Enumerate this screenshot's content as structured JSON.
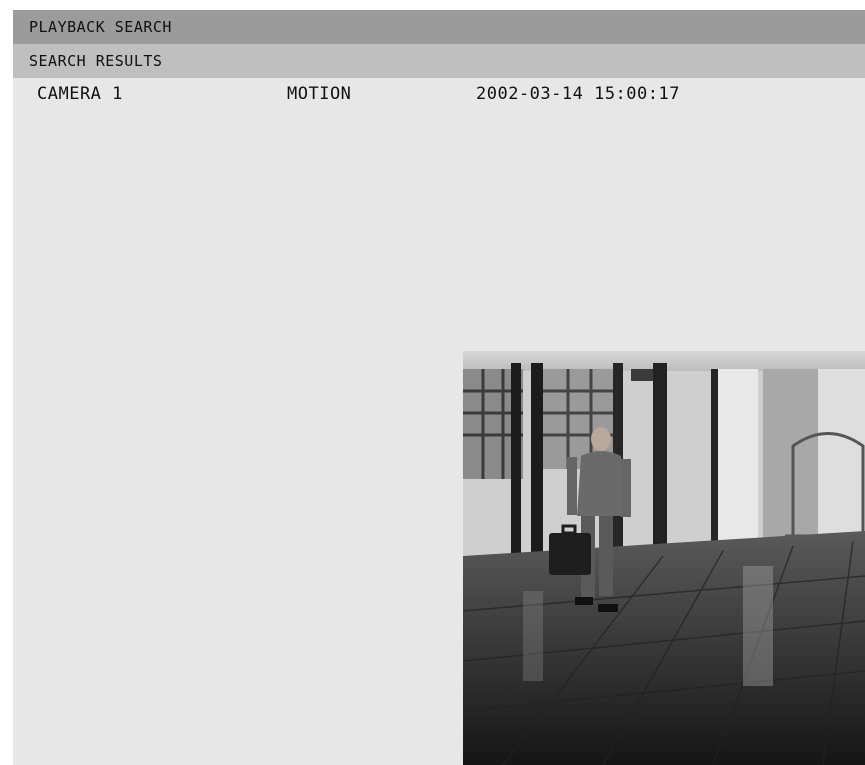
{
  "header": {
    "title": "PLAYBACK SEARCH"
  },
  "section": {
    "label": "SEARCH RESULTS"
  },
  "results": [
    {
      "camera": "CAMERA 1",
      "event": "MOTION",
      "timestamp": "2002-03-14 15:00:17"
    }
  ],
  "preview": {
    "description_icon": "camera-snapshot"
  }
}
